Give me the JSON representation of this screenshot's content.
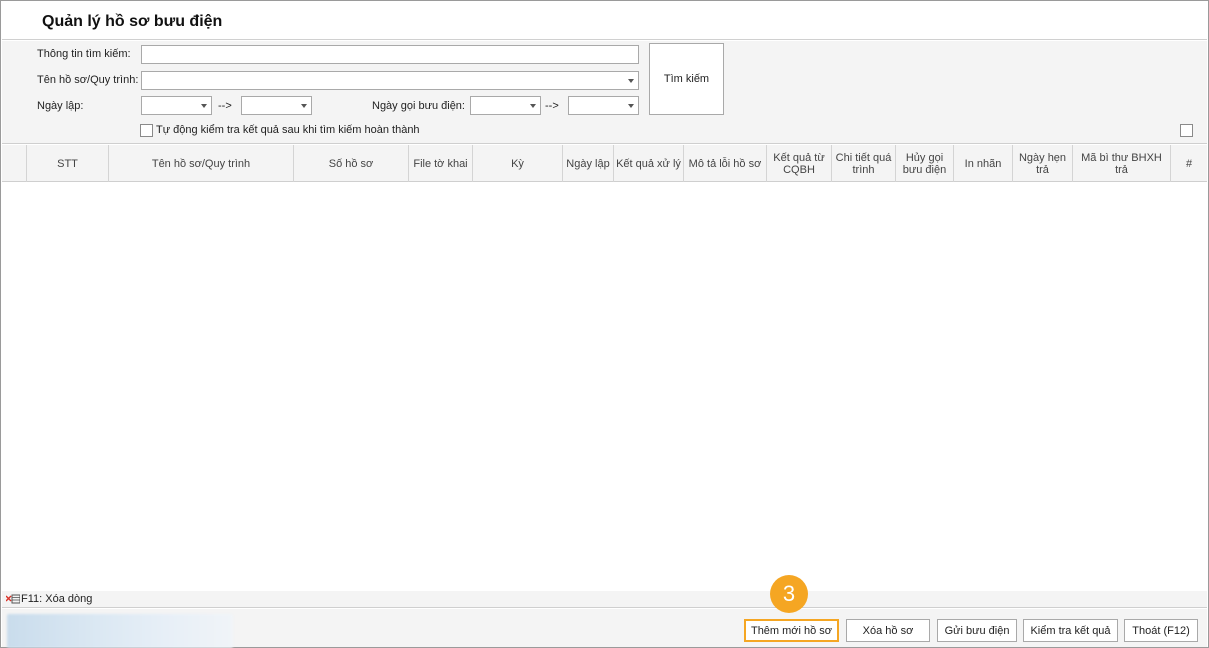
{
  "window": {
    "title": "Quản lý hồ sơ bưu điện"
  },
  "search": {
    "info_label": "Thông tin tìm kiếm:",
    "info_value": "",
    "name_label": "Tên hồ sơ/Quy trình:",
    "name_value": "",
    "date_label": "Ngày lập:",
    "date_from": "",
    "date_to": "",
    "arrow1": "-->",
    "post_date_label": "Ngày gọi bưu điện:",
    "post_from": "",
    "post_to": "",
    "arrow2": "-->",
    "search_button": "Tìm kiếm",
    "auto_check_label": "Tự động kiểm tra kết quả sau khi tìm kiếm hoàn thành",
    "auto_check_checked": false
  },
  "grid": {
    "columns": [
      "STT",
      "Tên hồ sơ/Quy trình",
      "Số hồ sơ",
      "File tờ khai",
      "Kỳ",
      "Ngày lập",
      "Kết quả xử lý",
      "Mô tả lỗi hồ sơ",
      "Kết quả từ CQBH",
      "Chi tiết quá trình",
      "Hủy gọi bưu điện",
      "In nhãn",
      "Ngày hẹn trả",
      "Mã bì thư BHXH trả",
      "#"
    ],
    "rows": []
  },
  "status": {
    "delete_hint": "F11: Xóa dòng"
  },
  "footer": {
    "add_button": "Thêm mới hồ sơ",
    "delete_button": "Xóa hồ sơ",
    "send_button": "Gửi bưu điện",
    "check_button": "Kiểm tra kết quả",
    "exit_button": "Thoát (F12)"
  },
  "annotation": {
    "step": "3"
  },
  "colors": {
    "highlight": "#f5a623",
    "panel": "#f4f4f4",
    "border": "#a9a9a9"
  }
}
